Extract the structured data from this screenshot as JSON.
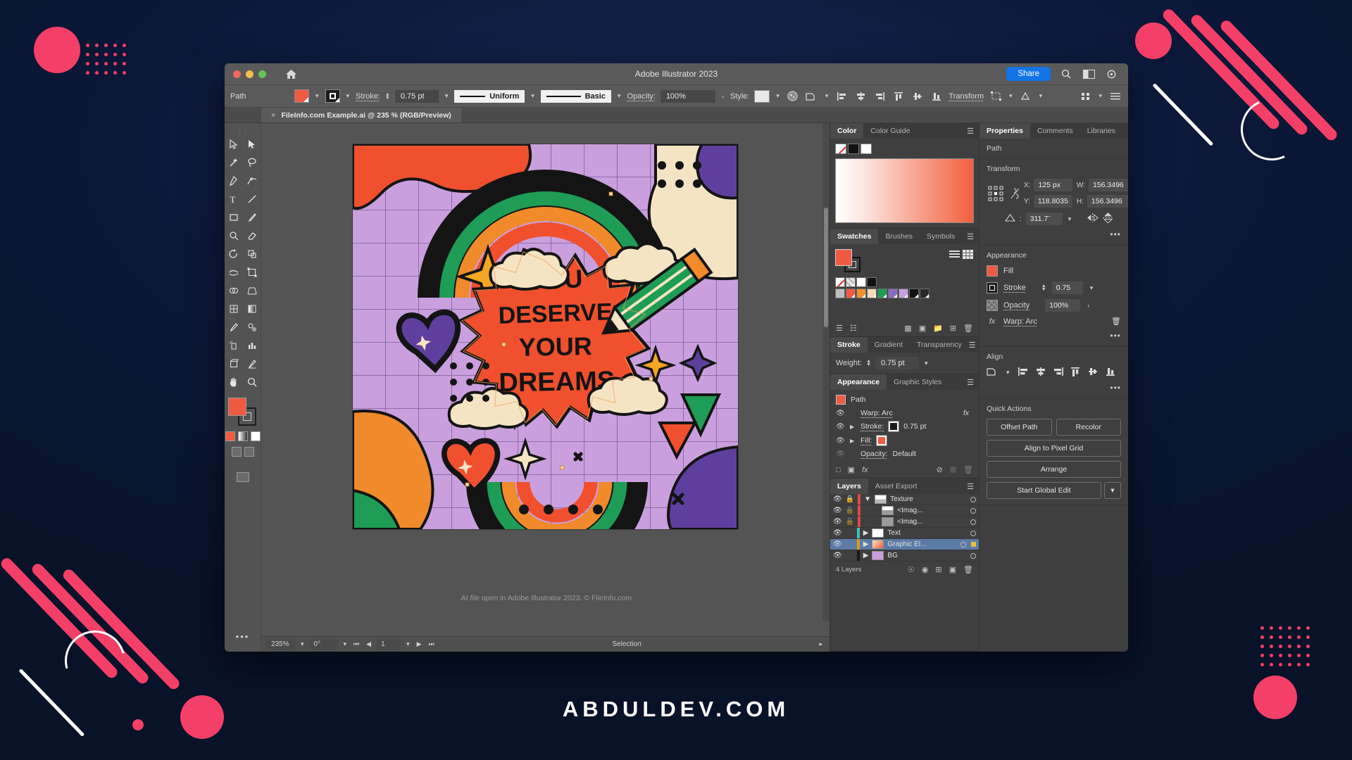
{
  "window": {
    "title": "Adobe Illustrator 2023",
    "share_label": "Share",
    "home_icon": "home-icon",
    "search_icon": "search-icon",
    "arrange_icon": "arrange-documents-icon",
    "workspace_icon": "workspace-switcher-icon"
  },
  "document_tab": {
    "close_glyph": "×",
    "label": "FileInfo.com Example.ai @ 235 % (RGB/Preview)"
  },
  "control_bar": {
    "object_label": "Path",
    "fill_swatch": "#ef5b42",
    "stroke_swatch": "#1c1c1c",
    "stroke_label": "Stroke:",
    "stroke_weight": "0.75 pt",
    "profile_label": "Uniform",
    "brush_label": "Basic",
    "opacity_label": "Opacity:",
    "opacity_value": "100%",
    "style_label": "Style:",
    "transform_label": "Transform",
    "icons": [
      "opacity-mask-icon",
      "shape-tool-icon",
      "align-left-icon",
      "align-center-h-icon",
      "align-right-icon",
      "align-top-icon",
      "align-center-v-icon",
      "align-bottom-icon",
      "isolate-icon",
      "effects-icon",
      "more-options-icon",
      "panel-menu-icon"
    ]
  },
  "tools": {
    "items": [
      "selection-tool",
      "direct-selection-tool",
      "magic-wand-tool",
      "lasso-tool",
      "pen-tool",
      "curvature-tool",
      "type-tool",
      "line-segment-tool",
      "rectangle-tool",
      "paintbrush-tool",
      "shaper-tool",
      "eraser-tool",
      "rotate-tool",
      "scale-tool",
      "width-tool",
      "free-transform-tool",
      "shape-builder-tool",
      "perspective-grid-tool",
      "mesh-tool",
      "gradient-tool",
      "eyedropper-tool",
      "blend-tool",
      "symbol-sprayer-tool",
      "column-graph-tool",
      "artboard-tool",
      "slice-tool",
      "hand-tool",
      "zoom-tool"
    ],
    "fill_color": "#ef5b42",
    "stroke_color": "#1d1d1d",
    "more_glyph": "•••"
  },
  "canvas": {
    "caption": ".AI file open in Adobe Illustrator 2023. © FileInfo.com",
    "artwork": {
      "headline_lines": [
        "YOU",
        "DESERVE",
        "YOUR",
        "DREAMS"
      ],
      "palette": {
        "background_lilac": "#c9a0dd",
        "burst_red": "#f0502e",
        "orange": "#f08a2a",
        "green": "#1f9c55",
        "purple": "#5f3f9e",
        "cream": "#f5e4c3",
        "outline": "#141414",
        "grid_line": "#8e6ba6"
      }
    }
  },
  "status_bar": {
    "zoom": "235%",
    "rotation": "0°",
    "artboard_number": "1",
    "tool_status": "Selection"
  },
  "color_panel": {
    "tabs": [
      "Color",
      "Color Guide"
    ],
    "active_tab": "Color",
    "swatches": [
      "none-swatch",
      "black-swatch",
      "white-swatch"
    ],
    "spectrum_from": "#ffffff",
    "spectrum_to": "#f2603f"
  },
  "swatches_panel": {
    "tabs": [
      "Swatches",
      "Brushes",
      "Symbols"
    ],
    "active_tab": "Swatches",
    "row1": [
      "#ffffff",
      "#dddddd",
      "#ffffff",
      "#111111"
    ],
    "row2": [
      "#bfbfbf",
      "#ef5b42",
      "#f0912f",
      "#f3dcb7",
      "#1f9c55",
      "#8a6bc2",
      "#c9a0dd",
      "#111111",
      "#2a2a2a"
    ]
  },
  "stroke_panel": {
    "tabs": [
      "Stroke",
      "Gradient",
      "Transparency"
    ],
    "active_tab": "Stroke",
    "weight_label": "Weight:",
    "weight_value": "0.75 pt"
  },
  "appearance_panel": {
    "tabs": [
      "Appearance",
      "Graphic Styles"
    ],
    "active_tab": "Appearance",
    "rows": [
      {
        "name": "Path",
        "type": "header",
        "swatch": "#ef5b42"
      },
      {
        "name": "Warp: Arc",
        "type": "effect",
        "fx": "fx"
      },
      {
        "name": "Stroke:",
        "type": "stroke",
        "value": "0.75 pt",
        "swatch": "#1c1c1c"
      },
      {
        "name": "Fill:",
        "type": "fill",
        "swatch": "#ef5b42"
      },
      {
        "name": "Opacity:",
        "type": "opacity",
        "value": "Default"
      }
    ]
  },
  "layers_panel": {
    "tabs": [
      "Layers",
      "Asset Export"
    ],
    "active_tab": "Layers",
    "rows": [
      {
        "name": "Texture",
        "locked": true,
        "expanded": true,
        "color": "#e04747",
        "indent": 0
      },
      {
        "name": "<Imag...",
        "locked": true,
        "expanded": false,
        "color": "#e04747",
        "indent": 1
      },
      {
        "name": "<Imag...",
        "locked": true,
        "expanded": false,
        "color": "#e04747",
        "indent": 1
      },
      {
        "name": "Text",
        "locked": false,
        "expanded": false,
        "color": "#3fbfc4",
        "indent": 0
      },
      {
        "name": "Graphic El...",
        "locked": false,
        "expanded": false,
        "color": "#d89b20",
        "indent": 0,
        "selected": true
      },
      {
        "name": "BG",
        "locked": false,
        "expanded": false,
        "color": "#1a1a1a",
        "indent": 0
      }
    ],
    "footer_count": "4 Layers"
  },
  "properties_panel": {
    "tabs": [
      "Properties",
      "Comments",
      "Libraries"
    ],
    "active_tab": "Properties",
    "object_type": "Path",
    "transform": {
      "title": "Transform",
      "x_label": "X:",
      "x_value": "125 px",
      "y_label": "Y:",
      "y_value": "118.8035",
      "w_label": "W:",
      "w_value": "156.3496",
      "h_label": "H:",
      "h_value": "156.3496",
      "angle_value": "311.7ˉ",
      "link_icon": "constrain-proportions-icon",
      "flip_h_icon": "flip-horizontal-icon",
      "flip_v_icon": "flip-vertical-icon",
      "more_glyph": "•••"
    },
    "appearance": {
      "title": "Appearance",
      "fill_label": "Fill",
      "fill_swatch": "#ef5b42",
      "stroke_label": "Stroke",
      "stroke_value": "0.75",
      "opacity_label": "Opacity",
      "opacity_value": "100%",
      "effect_label": "Warp: Arc",
      "fx_glyph": "fx",
      "trash_icon": "trash-icon",
      "more_glyph": "•••"
    },
    "align": {
      "title": "Align",
      "more_glyph": "•••"
    },
    "quick_actions": {
      "title": "Quick Actions",
      "offset_path": "Offset Path",
      "recolor": "Recolor",
      "align_pixel_grid": "Align to Pixel Grid",
      "arrange": "Arrange",
      "global_edit": "Start Global Edit"
    }
  },
  "watermark": {
    "text": "ABDULDEV.COM"
  }
}
